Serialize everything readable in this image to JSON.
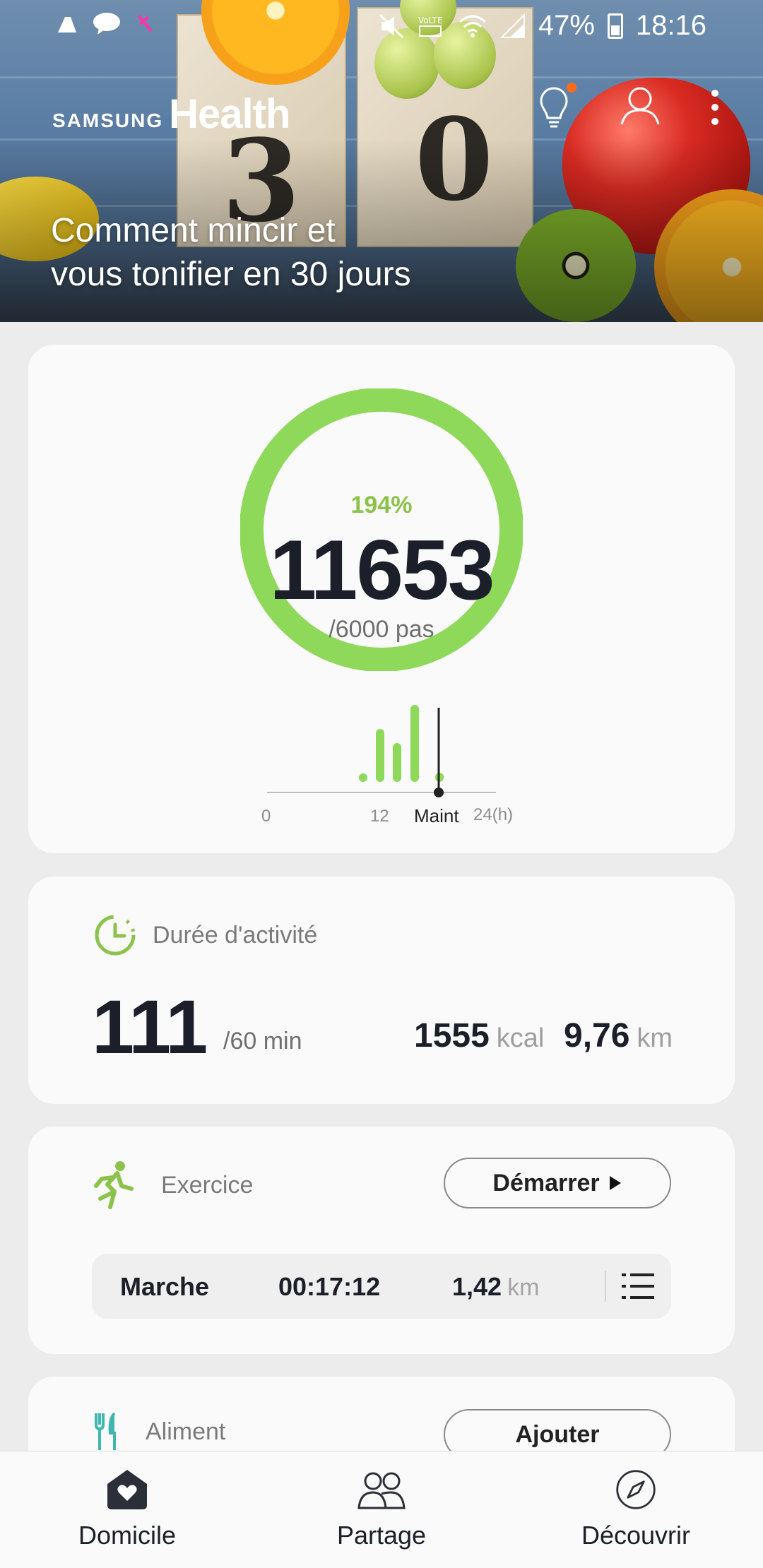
{
  "status_bar": {
    "battery": "47%",
    "time": "18:16",
    "left_icons": [
      "cleaner-icon",
      "talk-icon",
      "notification-icon"
    ],
    "right_icons": [
      "mute-icon",
      "volte-icon",
      "wifi-icon",
      "signal-icon",
      "battery-icon"
    ]
  },
  "header": {
    "brand_small": "SAMSUNG",
    "brand_large": "Health",
    "banner_title_line1": "Comment mincir et",
    "banner_title_line2": "vous tonifier en 30 jours",
    "calendar_digits": [
      "3",
      "0"
    ],
    "icons": [
      "lightbulb-icon",
      "profile-icon",
      "more-options-icon"
    ]
  },
  "steps": {
    "percent": "194%",
    "count": "11653",
    "goal_text": "/6000 pas",
    "ring_color": "#8ed85a",
    "progress_fraction": 1.0,
    "axis_labels": [
      "0",
      "12",
      "Maint",
      "24(h)"
    ]
  },
  "activity": {
    "title": "Durée d'activité",
    "minutes": "111",
    "minutes_goal": "/60 min",
    "kcal_value": "1555",
    "kcal_unit": "kcal",
    "distance_value": "9,76",
    "distance_unit": "km"
  },
  "exercise": {
    "title": "Exercice",
    "start_button": "Démarrer",
    "last_type": "Marche",
    "last_duration": "00:17:12",
    "last_distance_value": "1,42",
    "last_distance_unit": "km"
  },
  "food": {
    "title": "Aliment",
    "add_button": "Ajouter"
  },
  "bottom_nav": {
    "items": [
      {
        "label": "Domicile",
        "icon": "home-heart-icon"
      },
      {
        "label": "Partage",
        "icon": "people-icon"
      },
      {
        "label": "Découvrir",
        "icon": "compass-icon"
      }
    ]
  },
  "colors": {
    "accent_green": "#8bc34a",
    "text_dark": "#1b1f29",
    "teal_icon": "#3fb6b0"
  }
}
